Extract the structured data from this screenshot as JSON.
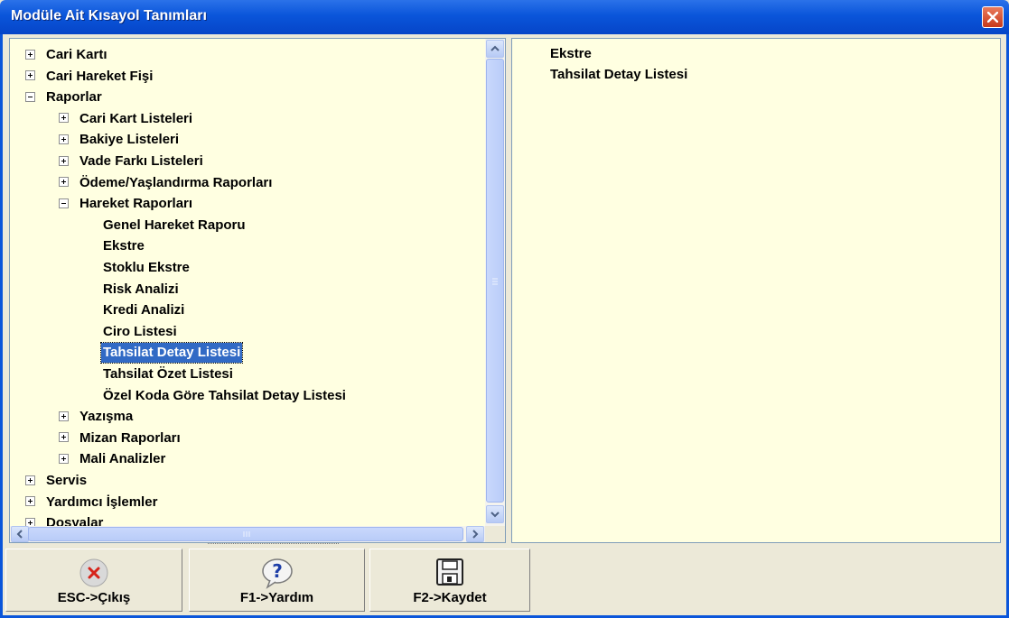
{
  "window": {
    "title": "Modüle Ait Kısayol Tanımları"
  },
  "tree": {
    "nodes": [
      {
        "label": "Cari Kartı",
        "level": 0,
        "expander": "plus"
      },
      {
        "label": "Cari Hareket Fişi",
        "level": 0,
        "expander": "plus"
      },
      {
        "label": "Raporlar",
        "level": 0,
        "expander": "minus"
      },
      {
        "label": "Cari Kart Listeleri",
        "level": 1,
        "expander": "plus"
      },
      {
        "label": "Bakiye Listeleri",
        "level": 1,
        "expander": "plus"
      },
      {
        "label": "Vade Farkı Listeleri",
        "level": 1,
        "expander": "plus"
      },
      {
        "label": "Ödeme/Yaşlandırma Raporları",
        "level": 1,
        "expander": "plus"
      },
      {
        "label": "Hareket Raporları",
        "level": 1,
        "expander": "minus"
      },
      {
        "label": "Genel Hareket Raporu",
        "level": 2,
        "expander": "none"
      },
      {
        "label": "Ekstre",
        "level": 2,
        "expander": "none"
      },
      {
        "label": "Stoklu Ekstre",
        "level": 2,
        "expander": "none"
      },
      {
        "label": "Risk Analizi",
        "level": 2,
        "expander": "none"
      },
      {
        "label": "Kredi Analizi",
        "level": 2,
        "expander": "none"
      },
      {
        "label": "Ciro Listesi",
        "level": 2,
        "expander": "none"
      },
      {
        "label": "Tahsilat Detay Listesi",
        "level": 2,
        "expander": "none",
        "selected": true
      },
      {
        "label": "Tahsilat Özet Listesi",
        "level": 2,
        "expander": "none"
      },
      {
        "label": "Özel Koda Göre Tahsilat Detay Listesi",
        "level": 2,
        "expander": "none"
      },
      {
        "label": "Yazışma",
        "level": 1,
        "expander": "plus"
      },
      {
        "label": "Mizan Raporları",
        "level": 1,
        "expander": "plus"
      },
      {
        "label": "Mali Analizler",
        "level": 1,
        "expander": "plus"
      },
      {
        "label": "Servis",
        "level": 0,
        "expander": "plus"
      },
      {
        "label": "Yardımcı İşlemler",
        "level": 0,
        "expander": "plus"
      },
      {
        "label": "Dosyalar",
        "level": 0,
        "expander": "plus"
      }
    ]
  },
  "shortcuts": [
    "Ekstre",
    "Tahsilat Detay Listesi"
  ],
  "toolbar": {
    "exit_label": "ESC->Çıkış",
    "help_label": "F1->Yardım",
    "save_label": "F2->Kaydet"
  },
  "colors": {
    "title_bar": "#0A55DA",
    "panel_bg": "#FFFFE1",
    "selection": "#316AC5",
    "close_button": "#D2481F"
  },
  "icons": {
    "close": "close-icon",
    "exit": "x-circle-icon",
    "help": "help-icon",
    "save": "floppy-disk-icon",
    "scroll_up": "arrow-up-icon",
    "scroll_down": "arrow-down-icon",
    "scroll_left": "arrow-left-icon",
    "scroll_right": "arrow-right-icon"
  }
}
